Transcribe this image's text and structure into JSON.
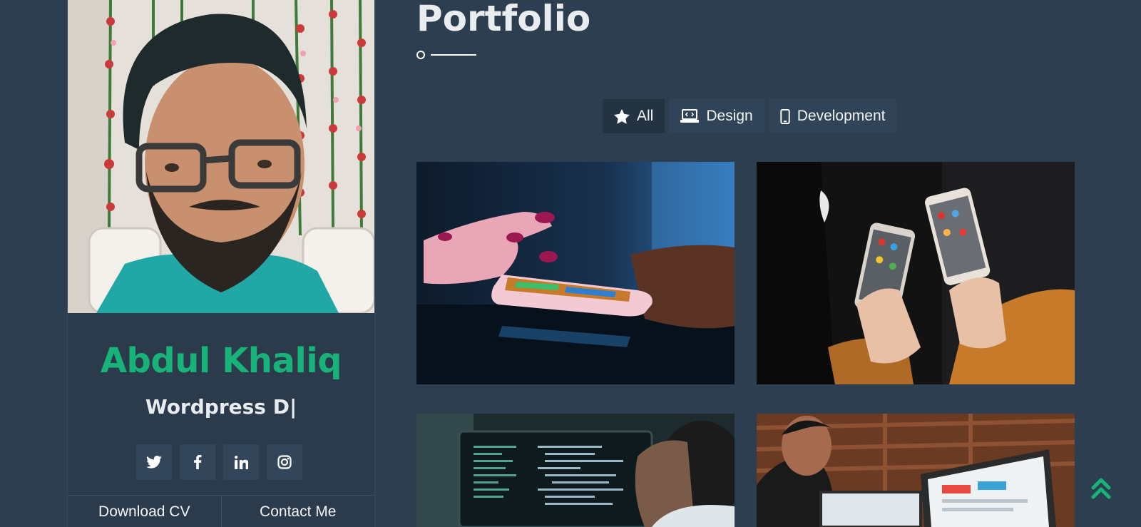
{
  "profile": {
    "name": "Abdul Khaliq",
    "role": "Wordpress D|",
    "social": [
      "twitter-icon",
      "facebook-icon",
      "linkedin-icon",
      "instagram-icon"
    ],
    "download_cv": "Download CV",
    "contact_me": "Contact Me"
  },
  "portfolio": {
    "title": "Portfolio",
    "filters": [
      {
        "label": "All",
        "icon": "star-icon",
        "active": true
      },
      {
        "label": "Design",
        "icon": "laptop-code-icon",
        "active": false
      },
      {
        "label": "Development",
        "icon": "mobile-icon",
        "active": false
      }
    ],
    "items": [
      "phone-on-table-image",
      "two-phones-image",
      "code-editor-image",
      "office-monitor-image"
    ]
  },
  "colors": {
    "background": "#2d3e50",
    "accent": "#18b378",
    "card": "#2b3b4c"
  },
  "scroll_top_icon": "double-chevron-up-icon"
}
